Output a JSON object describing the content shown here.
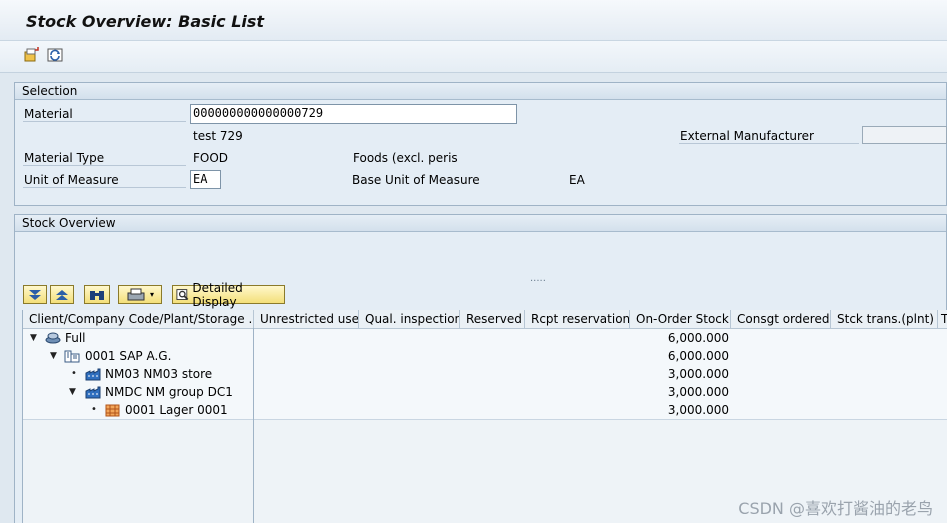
{
  "window": {
    "title": "Stock Overview: Basic List"
  },
  "selection": {
    "header": "Selection",
    "material_label": "Material",
    "material_value": "000000000000000729",
    "material_desc": "test 729",
    "ext_manufacturer_label": "External Manufacturer",
    "ext_manufacturer_value": "",
    "material_type_label": "Material Type",
    "material_type_value": "FOOD",
    "material_type_desc": "Foods (excl. peris",
    "uom_label": "Unit of Measure",
    "uom_value": "EA",
    "base_uom_label": "Base Unit of Measure",
    "base_uom_value": "EA"
  },
  "stock_overview": {
    "header": "Stock Overview",
    "splitter": ".....",
    "detailed_display_label": "Detailed Display",
    "columns": [
      "Client/Company Code/Plant/Storage ...",
      "Unrestricted use",
      "Qual. inspection",
      "Reserved",
      "Rcpt reservation",
      "On-Order Stock",
      "Consgt ordered",
      "Stck trans.(plnt)",
      "T"
    ],
    "rows": [
      {
        "label": "Full",
        "value": "6,000.000"
      },
      {
        "label": "0001 SAP A.G.",
        "value": "6,000.000"
      },
      {
        "label": "NM03 NM03 store",
        "value": "3,000.000"
      },
      {
        "label": "NMDC NM group DC1",
        "value": "3,000.000"
      },
      {
        "label": "0001 Lager 0001",
        "value": "3,000.000"
      }
    ]
  },
  "watermark": "CSDN @喜欢打酱油的老鸟"
}
